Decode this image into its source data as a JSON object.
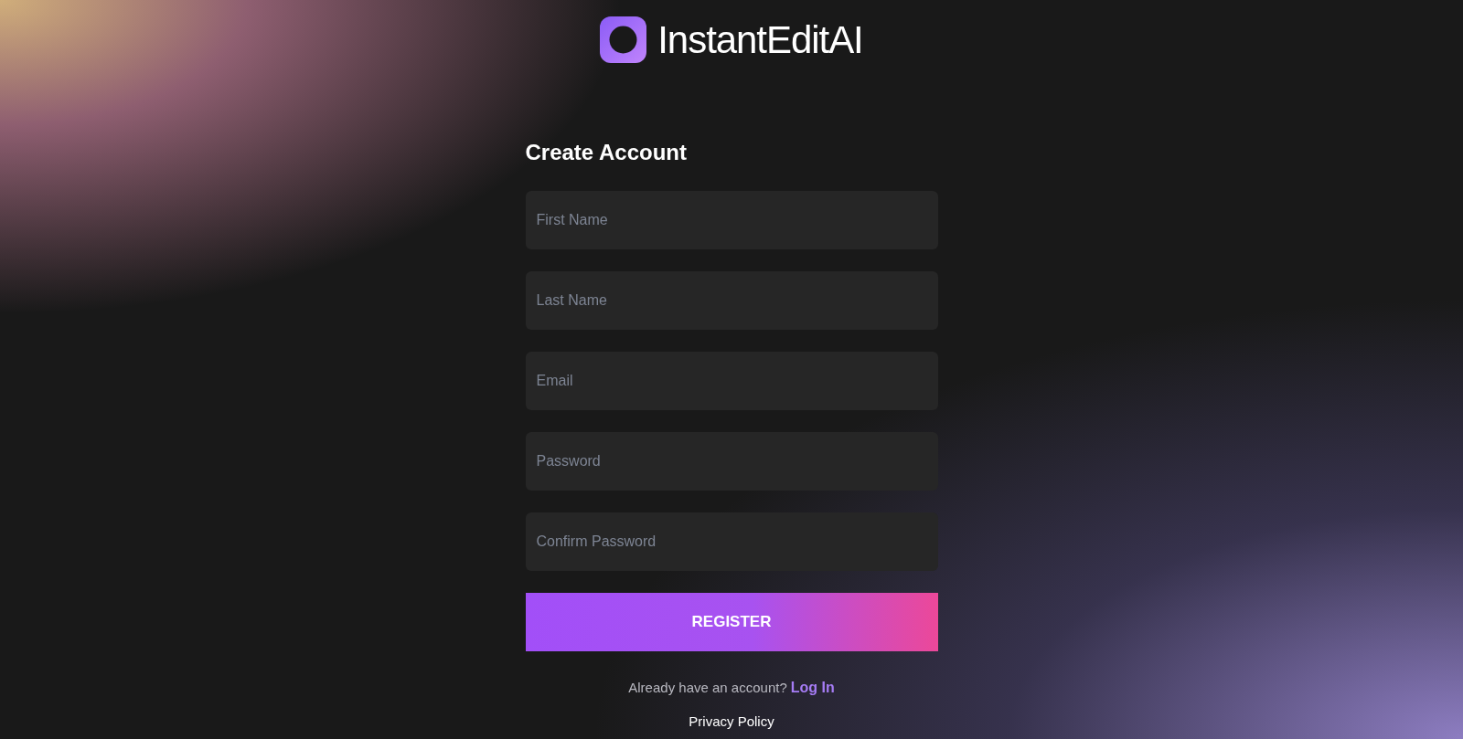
{
  "logo": {
    "text": "InstantEditAI"
  },
  "form": {
    "title": "Create Account",
    "fields": [
      {
        "placeholder": "First Name"
      },
      {
        "placeholder": "Last Name"
      },
      {
        "placeholder": "Email"
      },
      {
        "placeholder": "Password"
      },
      {
        "placeholder": "Confirm Password"
      }
    ],
    "submit": "REGISTER",
    "login_prompt": "Already have an account?",
    "login_link": "Log In",
    "privacy_link": "Privacy Policy"
  }
}
